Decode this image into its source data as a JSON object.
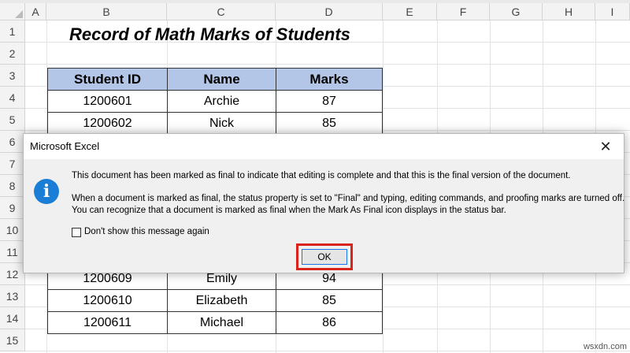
{
  "sheet": {
    "columns": [
      "A",
      "B",
      "C",
      "D",
      "E",
      "F",
      "G",
      "H",
      "I"
    ],
    "rows": [
      "1",
      "2",
      "3",
      "4",
      "5",
      "6",
      "7",
      "8",
      "9",
      "10",
      "11",
      "12",
      "13",
      "14",
      "15"
    ],
    "title": "Record of Math Marks of Students",
    "table": {
      "headers": [
        "Student ID",
        "Name",
        "Marks"
      ],
      "rows_top": [
        [
          "1200601",
          "Archie",
          "87"
        ],
        [
          "1200602",
          "Nick",
          "85"
        ]
      ],
      "rows_bottom": [
        [
          "1200609",
          "Emily",
          "94"
        ],
        [
          "1200610",
          "Elizabeth",
          "85"
        ],
        [
          "1200611",
          "Michael",
          "86"
        ]
      ],
      "header_color": "#b4c6e7"
    }
  },
  "dialog": {
    "title": "Microsoft Excel",
    "close_glyph": "✕",
    "icon": "info-icon",
    "icon_glyph": "i",
    "message_1": "This document has been marked as final to indicate that editing is complete and that this is the final version of the document.",
    "message_2": "When a document is marked as final, the status property is set to \"Final\" and typing, editing commands, and proofing marks are turned off.",
    "message_3": "You can recognize that a document is marked as final when the Mark As Final icon displays in the status bar.",
    "checkbox_label": "Don't show this message again",
    "checkbox_checked": false,
    "ok_label": "OK",
    "highlight_color": "#d9241c"
  },
  "watermark": "wsxdn.com"
}
